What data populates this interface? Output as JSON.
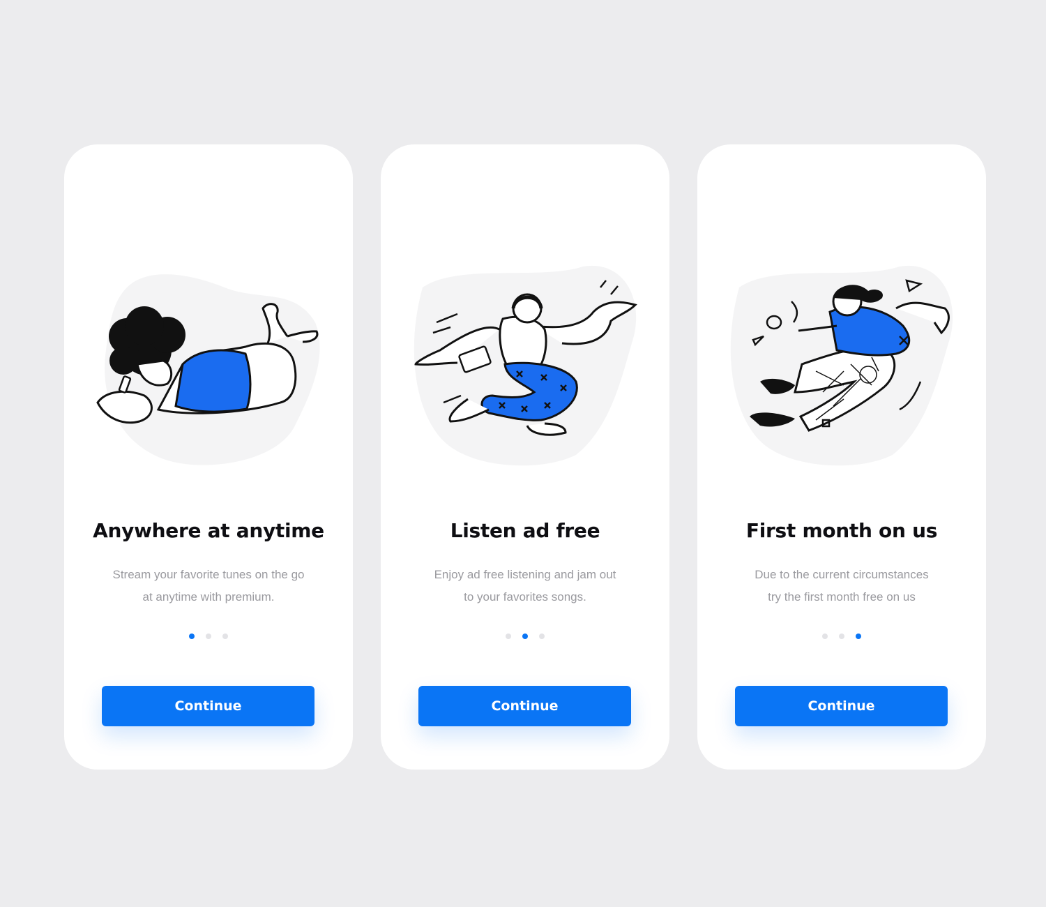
{
  "accent_color": "#0a75f5",
  "cards": [
    {
      "title": "Anywhere at anytime",
      "description_line_1": "Stream your favorite tunes on the go",
      "description_line_2": "at anytime with premium.",
      "active_page": 1,
      "page_count": 3,
      "button_label": "Continue",
      "illustration": "person-lying-with-phone-illustration"
    },
    {
      "title": "Listen ad free",
      "description_line_1": "Enjoy ad free listening and jam out",
      "description_line_2": "to your favorites songs.",
      "active_page": 2,
      "page_count": 3,
      "button_label": "Continue",
      "illustration": "person-dancing-with-headphones-illustration"
    },
    {
      "title": "First month on us",
      "description_line_1": "Due to the current circumstances",
      "description_line_2": "try the first month free on us",
      "active_page": 3,
      "page_count": 3,
      "button_label": "Continue",
      "illustration": "person-jumping-illustration"
    }
  ]
}
